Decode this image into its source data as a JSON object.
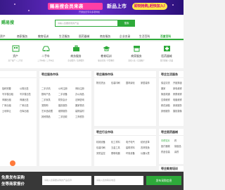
{
  "banner": {
    "promo_text": "赐易搜会员来袭",
    "new_text": "新品上市",
    "cta_text": "即刻抢购,赶快加入!",
    "sub_text": "开通会员专享多项特权"
  },
  "header": {
    "logo_text": "赐易搜",
    "search_placeholder": "请输入您要搜索的产品",
    "search_button": "搜索"
  },
  "nav": {
    "items": [
      "资产",
      "商家服务",
      "教育培训",
      "生活服务",
      "医药器械",
      "商务服务",
      "企业名录",
      "生活百科",
      "百度百科"
    ]
  },
  "categories": [
    {
      "label": "资产",
      "sub": "房产资产 / 二手房"
    },
    {
      "label": "二手车",
      "sub": "二手车收 / 二手车卖"
    },
    {
      "label": "商务服务",
      "sub": "企业服务 / 法律服务"
    },
    {
      "label": "教育培训",
      "sub": "职业培训 / 学历教育"
    },
    {
      "label": "商家服务",
      "sub": "商家入驻 / 店铺推广"
    },
    {
      "label": "医药器械",
      "sub": "医疗器械 / 药品"
    }
  ],
  "panels": {
    "left": {
      "title": "",
      "rows": [
        [
          "独栋别墅",
          "公寓出售"
        ],
        [
          "写字楼出租",
          "写字楼出售"
        ],
        [
          "商铺出租",
          "商铺出售"
        ],
        [
          "厂房出租",
          "厂房出售"
        ],
        [
          "土地转让",
          "仓库出租"
        ]
      ]
    },
    "service": {
      "title": "枣庄服务市场",
      "rows": [
        [
          "二手手机",
          "公司注册",
          "商标注册"
        ],
        [
          "数码产品",
          "二手设备",
          "办公用品"
        ],
        [
          "二手家具",
          "财务会计",
          "法律咨询"
        ],
        [
          "宠物狗",
          "婚庆服务",
          "搬家物流"
        ],
        [
          "艺术品收藏",
          "维修服务",
          "装修建材"
        ],
        [
          "其他物品",
          "二手回收",
          "工商税务"
        ]
      ]
    },
    "logistics": {
      "title": "枣庄装饰市场",
      "rows": [
        [
          "物流货运",
          "包装印刷",
          "园林绿化",
          "家居装饰"
        ]
      ]
    },
    "right": {
      "title": "枣庄生活服务",
      "rows": [
        [
          "保洁清洗",
          "开锁换锁"
        ],
        [
          "搬家",
          "家电维修"
        ],
        [
          "管道疏通",
          "房屋维修"
        ],
        [
          "空调维修",
          "电脑维修"
        ],
        [
          "鲜花绿植",
          "家政服务"
        ],
        [
          "其他服务",
          "摄影摄像"
        ]
      ]
    },
    "medical": {
      "title": "枣庄医药器械",
      "rows": [
        [
          "中药饮片",
          "药"
        ],
        [
          "医疗器械",
          "保健品"
        ],
        [
          "药品包装",
          "兽药"
        ]
      ]
    },
    "job": {
      "title": "枣庄行业市场",
      "rows": [
        [
          "机械设备",
          "化工材料",
          "电子电气",
          "纺织皮革"
        ],
        [
          "包装印刷",
          "五金工具",
          "建筑材料",
          "农林牧渔"
        ],
        [
          "安防监控",
          "照明电器",
          "环保设备",
          "仪器仪表"
        ]
      ]
    },
    "education": {
      "title": "枣庄教育培训",
      "rows": [
        [
          "职业技能",
          "学历"
        ],
        [
          "语言培训",
          "家教"
        ]
      ]
    }
  },
  "float": {
    "title1": "免费发布采购",
    "title2": "坐等商家报价",
    "input1_placeholder": "请输入您需要采购的产品名称",
    "input2_placeholder": "请输入您的联系电话",
    "button": "发布采购信息"
  },
  "colors": {
    "accent": "#2eaa3a",
    "banner": "#6a2bd0",
    "promo": "#ff3ea5"
  }
}
